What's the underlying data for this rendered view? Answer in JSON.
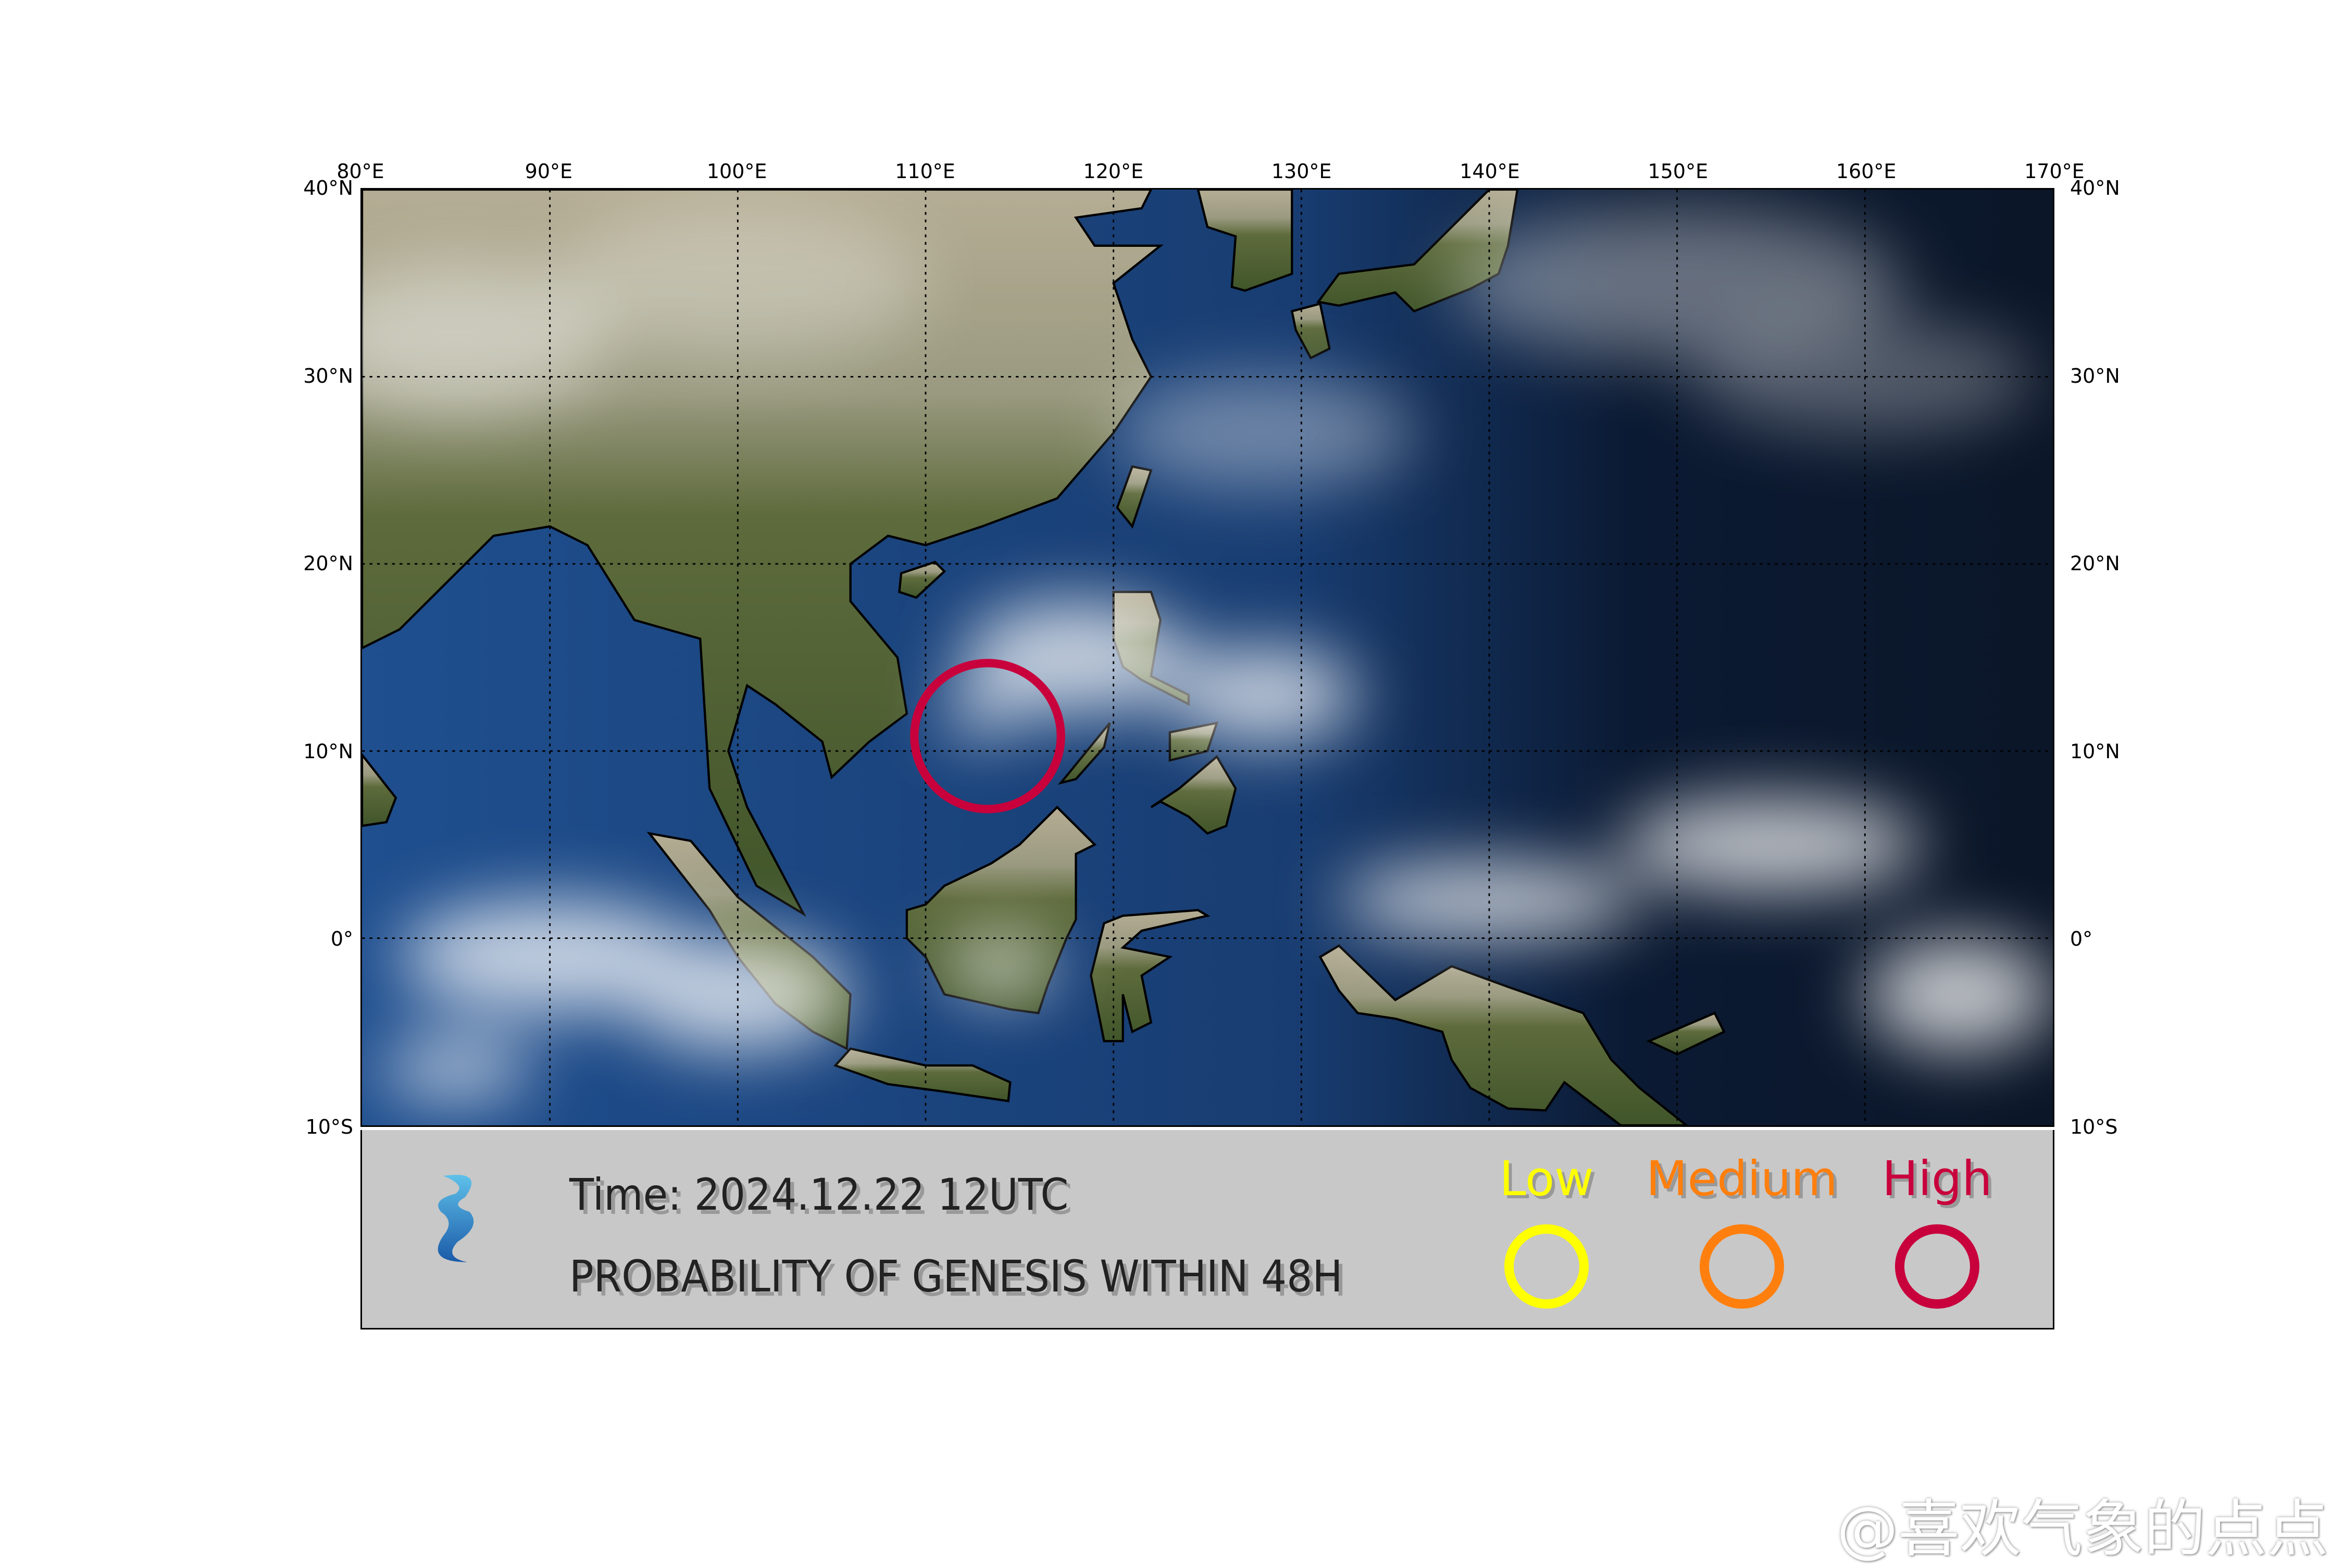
{
  "map": {
    "lon_range": [
      80,
      170
    ],
    "lat_range": [
      -10,
      40
    ],
    "grid_step": 10,
    "grid": true,
    "top_ticks": [
      "80°E",
      "90°E",
      "100°E",
      "110°E",
      "120°E",
      "130°E",
      "140°E",
      "150°E",
      "160°E",
      "170°E"
    ],
    "lat_ticks": [
      "40°N",
      "30°N",
      "20°N",
      "10°N",
      "0°",
      "10°S"
    ],
    "genesis_areas": [
      {
        "level": "High",
        "lon": 113.3,
        "lat": 10.8,
        "radius_deg": 3.9
      }
    ]
  },
  "legend": {
    "time": "Time: 2024.12.22 12UTC",
    "title": "PROBABILITY OF GENESIS WITHIN 48H",
    "levels": [
      {
        "label": "Low",
        "color": "#ffff00"
      },
      {
        "label": "Medium",
        "color": "#ff7f0e"
      },
      {
        "label": "High",
        "color": "#c8003c"
      }
    ]
  },
  "watermark": "@喜欢气象的点点"
}
